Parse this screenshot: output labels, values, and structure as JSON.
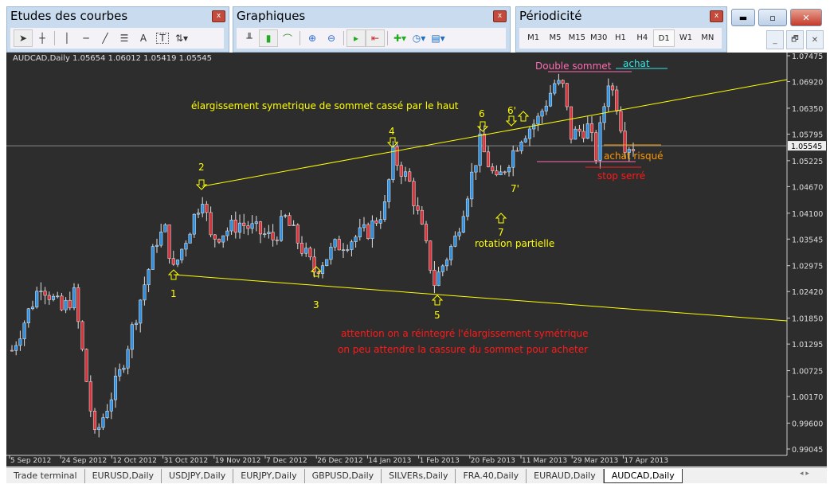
{
  "panels": {
    "studies": {
      "title": "Etudes des courbes",
      "close": "x",
      "tools": [
        "cursor-icon",
        "crosshair-icon",
        "vertical-line-icon",
        "horizontal-line-icon",
        "trendline-icon",
        "fibonacci-icon",
        "text-icon",
        "text-label-icon",
        "arrows-icon"
      ],
      "text_glyph": "A",
      "label_glyph": "T"
    },
    "charts": {
      "title": "Graphiques",
      "close": "x"
    },
    "period": {
      "title": "Périodicité",
      "close": "x",
      "items": [
        "M1",
        "M5",
        "M15",
        "M30",
        "H1",
        "H4",
        "D1",
        "W1",
        "MN"
      ],
      "active": "D1"
    }
  },
  "chart": {
    "header": "AUDCAD,Daily  1.05654 1.06012 1.05419 1.05545",
    "current_price": "1.05545",
    "price_axis": [
      "1.07475",
      "1.06920",
      "1.06350",
      "1.05795",
      "1.05225",
      "1.04670",
      "1.04100",
      "1.03545",
      "1.02975",
      "1.02420",
      "1.01850",
      "1.01295",
      "1.00725",
      "1.00170",
      "0.99600",
      "0.99045"
    ],
    "time_axis": [
      "5 Sep 2012",
      "24 Sep 2012",
      "12 Oct 2012",
      "31 Oct 2012",
      "19 Nov 2012",
      "7 Dec 2012",
      "26 Dec 2012",
      "14 Jan 2013",
      "1 Feb 2013",
      "20 Feb 2013",
      "11 Mar 2013",
      "29 Mar 2013",
      "17 Apr 2013"
    ],
    "price_min": 0.99045,
    "price_max": 1.07475,
    "colors": {
      "bull": "#2f8fe0",
      "bear": "#d8333a",
      "wick": "#e0e0e0",
      "trend": "#ffff00"
    },
    "waypoints": [
      [
        0,
        1.0116
      ],
      [
        7,
        1.0261
      ],
      [
        12,
        1.0201
      ],
      [
        15,
        1.0235
      ],
      [
        20,
        0.9928
      ],
      [
        26,
        1.0065
      ],
      [
        35,
        1.0355
      ],
      [
        37,
        1.0372
      ],
      [
        39,
        1.0287
      ],
      [
        46,
        1.0449
      ],
      [
        48,
        1.0355
      ],
      [
        55,
        1.0389
      ],
      [
        63,
        1.0355
      ],
      [
        66,
        1.0398
      ],
      [
        73,
        1.0287
      ],
      [
        78,
        1.0338
      ],
      [
        86,
        1.0372
      ],
      [
        90,
        1.0423
      ],
      [
        92,
        1.0534
      ],
      [
        96,
        1.0474
      ],
      [
        99,
        1.0372
      ],
      [
        102,
        1.0261
      ],
      [
        107,
        1.0355
      ],
      [
        110,
        1.0457
      ],
      [
        113,
        1.056
      ],
      [
        117,
        1.0474
      ],
      [
        120,
        1.0526
      ],
      [
        123,
        1.0577
      ],
      [
        127,
        1.0611
      ],
      [
        131,
        1.0688
      ],
      [
        133,
        1.0679
      ],
      [
        135,
        1.0577
      ],
      [
        139,
        1.0594
      ],
      [
        141,
        1.0534
      ],
      [
        144,
        1.0696
      ],
      [
        146,
        1.0645
      ],
      [
        148,
        1.056
      ],
      [
        150,
        1.0554
      ]
    ],
    "annotations": {
      "title": "élargissement symetrique de sommet cassé par le haut",
      "double_top": "Double sommet",
      "buy": "achat",
      "risky_buy": "achat risqué",
      "tight_stop": "stop serré",
      "partial_rotation": "rotation partielle",
      "warning1": "attention on a réintegré l'élargissement symétrique",
      "warning2": "on peu attendre la cassure du sommet pour acheter",
      "labels": [
        "1",
        "2",
        "3",
        "4",
        "5",
        "6",
        "6'",
        "7",
        "7'"
      ]
    }
  },
  "tabs": [
    "Trade terminal",
    "EURUSD,Daily",
    "USDJPY,Daily",
    "EURJPY,Daily",
    "GBPUSD,Daily",
    "SILVERs,Daily",
    "FRA.40,Daily",
    "EURAUD,Daily",
    "AUDCAD,Daily"
  ],
  "active_tab": "AUDCAD,Daily"
}
